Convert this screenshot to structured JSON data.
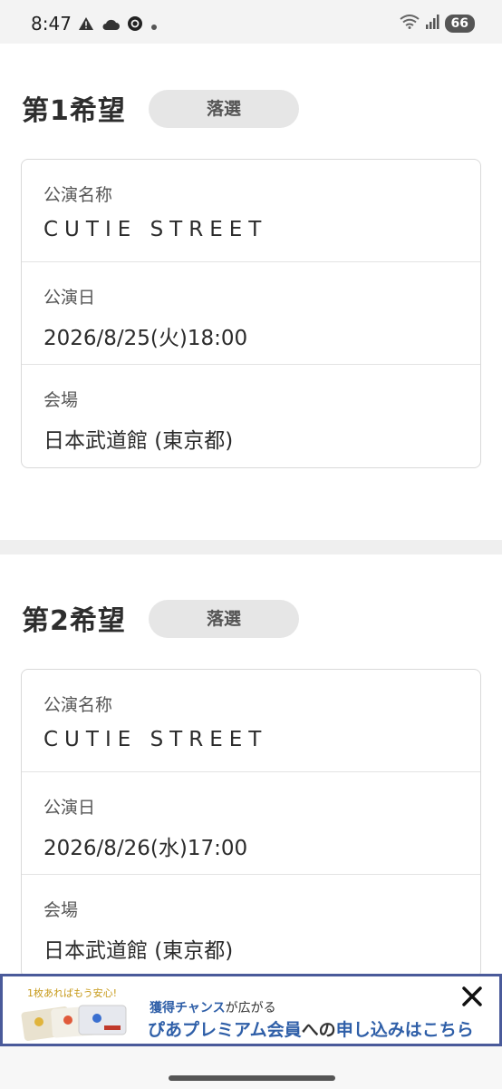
{
  "status_bar": {
    "time": "8:47",
    "battery": "66",
    "icons": [
      "warning-icon",
      "cloud-icon",
      "threads-icon",
      "dot-icon",
      "wifi-icon",
      "signal-icon"
    ]
  },
  "sections": [
    {
      "title": "第1希望",
      "status": "落選",
      "rows": [
        {
          "label": "公演名称",
          "value": "CUTIE STREET"
        },
        {
          "label": "公演日",
          "value": "2026/8/25(火)18:00"
        },
        {
          "label": "会場",
          "value": "日本武道館 (東京都)"
        }
      ]
    },
    {
      "title": "第2希望",
      "status": "落選",
      "rows": [
        {
          "label": "公演名称",
          "value": "CUTIE STREET"
        },
        {
          "label": "公演日",
          "value": "2026/8/26(水)17:00"
        },
        {
          "label": "会場",
          "value": "日本武道館 (東京都)"
        }
      ]
    }
  ],
  "banner": {
    "small_text": "1枚あればもう安心!",
    "line1_highlight": "獲得チャンス",
    "line1_rest": "が広がる",
    "line2_highlight1": "ぴあプレミアム会員",
    "line2_mid": "への",
    "line2_highlight2": "申し込みはこちら",
    "accent_color": "#2f5fa8"
  },
  "colors": {
    "badge_bg": "#e6e6e6",
    "banner_border": "#4a5a9a"
  }
}
